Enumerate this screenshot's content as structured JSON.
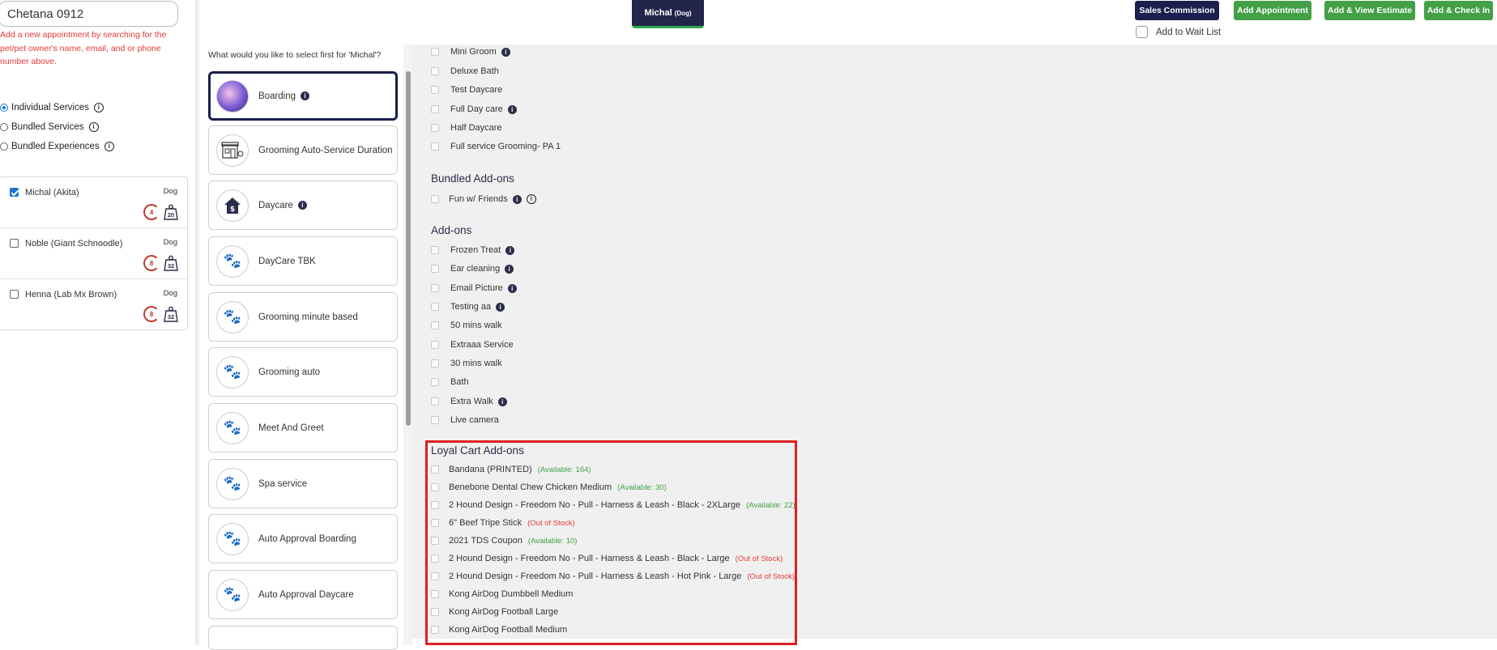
{
  "header": {
    "pet_tab_name": "Michal",
    "pet_tab_species": "(Dog)",
    "buttons": {
      "sales_commission": "Sales Commission",
      "add_appointment": "Add Appointment",
      "add_view_estimate": "Add & View Estimate",
      "add_check_in": "Add & Check In"
    },
    "waitlist_label": "Add to Wait List"
  },
  "left": {
    "search_value": "Chetana 0912",
    "helper_text": "Add a new appointment by searching for the pet/pet owner's name, email, and or phone number above.",
    "service_types": [
      {
        "label": "Individual Services",
        "selected": true
      },
      {
        "label": "Bundled Services",
        "selected": false
      },
      {
        "label": "Bundled Experiences",
        "selected": false
      }
    ],
    "pets": [
      {
        "name": "Michal (Akita)",
        "species": "Dog",
        "visits": "4",
        "weight": "20",
        "checked": true
      },
      {
        "name": "Noble (Giant Schnoodle)",
        "species": "Dog",
        "visits": "8",
        "weight": "32",
        "checked": false
      },
      {
        "name": "Henna (Lab Mx Brown)",
        "species": "Dog",
        "visits": "8",
        "weight": "32",
        "checked": false
      }
    ]
  },
  "services": {
    "prompt": "What would you like to select first for 'Michal'?",
    "items": [
      {
        "name": "Boarding",
        "icon": "boarding-photo-icon",
        "info": true,
        "selected": true
      },
      {
        "name": "Grooming Auto-Service Duration",
        "icon": "groom-shop-icon",
        "info": false
      },
      {
        "name": "Daycare",
        "icon": "daycare-house-icon",
        "info": true
      },
      {
        "name": "DayCare TBK",
        "icon": "paw-icon",
        "info": false
      },
      {
        "name": "Grooming minute based",
        "icon": "paw-icon",
        "info": false
      },
      {
        "name": "Grooming auto",
        "icon": "paw-icon",
        "info": false
      },
      {
        "name": "Meet And Greet",
        "icon": "paw-icon",
        "info": false
      },
      {
        "name": "Spa service",
        "icon": "paw-icon",
        "info": false
      },
      {
        "name": "Auto Approval Boarding",
        "icon": "paw-icon",
        "info": false
      },
      {
        "name": "Auto Approval Daycare",
        "icon": "paw-icon",
        "info": false
      }
    ]
  },
  "options": {
    "services": [
      {
        "label": "Mini Groom",
        "info": true
      },
      {
        "label": "Deluxe Bath",
        "info": false
      },
      {
        "label": "Test Daycare",
        "info": false
      },
      {
        "label": "Full Day care",
        "info": true
      },
      {
        "label": "Half Daycare",
        "info": false
      },
      {
        "label": "Full service Grooming- PA 1",
        "info": false
      }
    ],
    "bundled_addons_title": "Bundled Add-ons",
    "bundled_addons": [
      {
        "label": "Fun w/ Friends"
      }
    ],
    "addons_title": "Add-ons",
    "addons": [
      {
        "label": "Frozen Treat",
        "info": true
      },
      {
        "label": "Ear cleaning",
        "info": true
      },
      {
        "label": "Email Picture",
        "info": true
      },
      {
        "label": "Testing aa",
        "info": true
      },
      {
        "label": "50 mins walk",
        "info": false
      },
      {
        "label": "Extraaa Service",
        "info": false
      },
      {
        "label": "30 mins walk",
        "info": false
      },
      {
        "label": "Bath",
        "info": false
      },
      {
        "label": "Extra Walk",
        "info": true
      },
      {
        "label": "Live camera",
        "info": false
      }
    ],
    "loyal_title": "Loyal Cart Add-ons",
    "loyal": [
      {
        "label": "Bandana (PRINTED)",
        "status": "(Available: 164)",
        "kind": "avail"
      },
      {
        "label": "Benebone Dental Chew Chicken Medium",
        "status": "(Available: 30)",
        "kind": "avail"
      },
      {
        "label": "2 Hound Design - Freedom No - Pull - Harness & Leash - Black - 2XLarge",
        "status": "(Available: 22)",
        "kind": "avail"
      },
      {
        "label": "6\" Beef Tripe Stick",
        "status": "(Out of Stock)",
        "kind": "oos"
      },
      {
        "label": "2021 TDS Coupon",
        "status": "(Available: 10)",
        "kind": "avail"
      },
      {
        "label": "2 Hound Design - Freedom No - Pull - Harness & Leash - Black - Large",
        "status": "(Out of Stock)",
        "kind": "oos"
      },
      {
        "label": "2 Hound Design - Freedom No - Pull - Harness & Leash - Hot Pink - Large",
        "status": "(Out of Stock)",
        "kind": "oos"
      },
      {
        "label": "Kong AirDog Dumbbell Medium",
        "status": "",
        "kind": ""
      },
      {
        "label": "Kong AirDog Football Large",
        "status": "",
        "kind": ""
      },
      {
        "label": "Kong AirDog Football Medium",
        "status": "",
        "kind": ""
      }
    ]
  },
  "colors": {
    "navy": "#1b1f4d",
    "green": "#43a047",
    "red": "#e53935",
    "highlight": "#e02020"
  }
}
